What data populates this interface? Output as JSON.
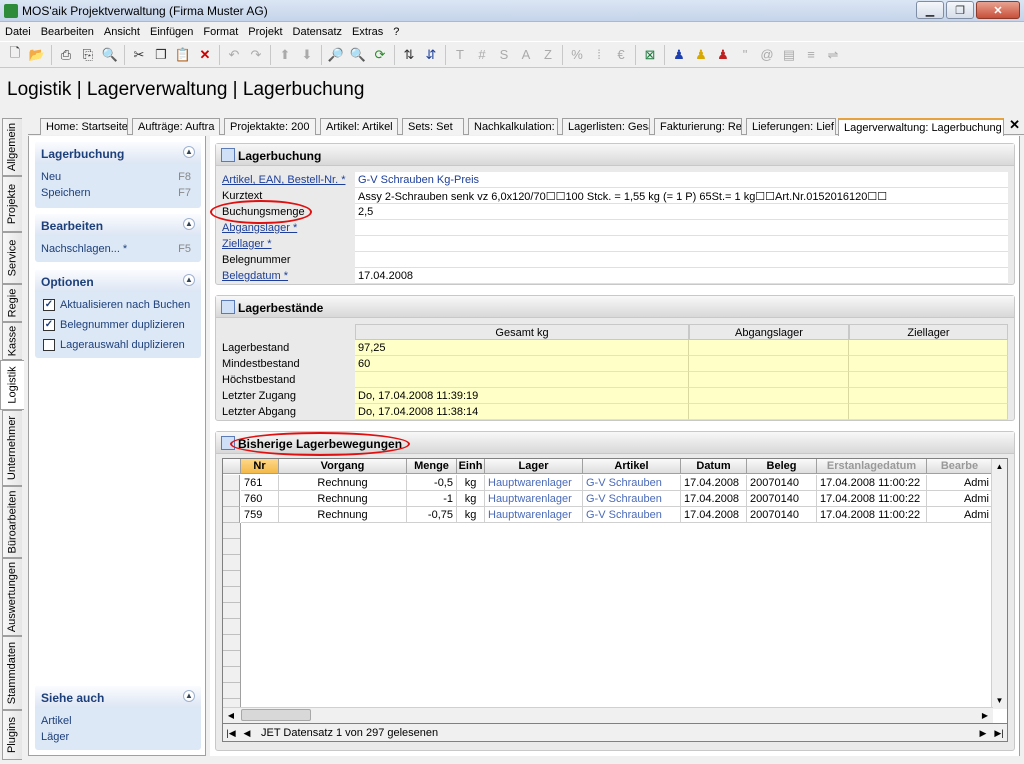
{
  "window": {
    "title": "MOS'aik Projektverwaltung (Firma Muster AG)"
  },
  "menu": [
    "Datei",
    "Bearbeiten",
    "Ansicht",
    "Einfügen",
    "Format",
    "Projekt",
    "Datensatz",
    "Extras",
    "?"
  ],
  "page_title": "Logistik | Lagerverwaltung | Lagerbuchung",
  "vtabs": [
    "Allgemein",
    "Projekte",
    "Service",
    "Regie",
    "Kasse",
    "Logistik",
    "Unternehmer",
    "Büroarbeiten",
    "Auswertungen",
    "Stammdaten",
    "Plugins"
  ],
  "tabs": [
    "Home: Startseite",
    "Aufträge: Auftra",
    "Projektakte: 200",
    "Artikel: Artikel",
    "Sets: Set",
    "Nachkalkulation: I",
    "Lagerlisten: Gesa",
    "Fakturierung: Re",
    "Lieferungen: Lief",
    "Lagerverwaltung: Lagerbuchung"
  ],
  "taskpane": {
    "lagerbuchung": {
      "title": "Lagerbuchung",
      "items": [
        {
          "label": "Neu",
          "key": "F8"
        },
        {
          "label": "Speichern",
          "key": "F7"
        }
      ]
    },
    "bearbeiten": {
      "title": "Bearbeiten",
      "items": [
        {
          "label": "Nachschlagen... *",
          "key": "F5"
        }
      ]
    },
    "optionen": {
      "title": "Optionen",
      "items": [
        {
          "label": "Aktualisieren nach Buchen",
          "checked": "✓"
        },
        {
          "label": "Belegnummer duplizieren",
          "checked": "✓"
        },
        {
          "label": "Lagerauswahl duplizieren",
          "checked": ""
        }
      ]
    },
    "siehe": {
      "title": "Siehe auch",
      "items": [
        {
          "label": "Artikel"
        },
        {
          "label": "Läger"
        }
      ]
    }
  },
  "booking": {
    "title": "Lagerbuchung",
    "fields": [
      {
        "label": "Artikel, EAN, Bestell-Nr. *",
        "value": "G-V Schrauben Kg-Preis"
      },
      {
        "label": "Kurztext",
        "value": "Assy 2-Schrauben senk vz 6,0x120/70☐☐100 Stck. = 1,55 kg (= 1 P) 65St.= 1 kg☐☐Art.Nr.0152016120☐☐"
      },
      {
        "label": "Buchungsmenge",
        "value": "2,5"
      },
      {
        "label": "Abgangslager *",
        "value": ""
      },
      {
        "label": "Ziellager *",
        "value": ""
      },
      {
        "label": "Belegnummer",
        "value": ""
      },
      {
        "label": "Belegdatum *",
        "value": "17.04.2008"
      }
    ]
  },
  "stock": {
    "title": "Lagerbestände",
    "columns": [
      "Gesamt kg",
      "Abgangslager",
      "Ziellager"
    ],
    "rows": [
      {
        "label": "Lagerbestand",
        "values": [
          "97,25",
          "",
          ""
        ]
      },
      {
        "label": "Mindestbestand",
        "values": [
          "60",
          "",
          ""
        ]
      },
      {
        "label": "Höchstbestand",
        "values": [
          "",
          "",
          ""
        ]
      },
      {
        "label": "Letzter Zugang",
        "values": [
          "Do, 17.04.2008 11:39:19",
          "",
          ""
        ]
      },
      {
        "label": "Letzter Abgang",
        "values": [
          "Do, 17.04.2008 11:38:14",
          "",
          ""
        ]
      }
    ]
  },
  "movements": {
    "title": "Bisherige Lagerbewegungen",
    "columns": [
      "Nr",
      "Vorgang",
      "Menge",
      "Einh",
      "Lager",
      "Artikel",
      "Datum",
      "Beleg",
      "Erstanlagedatum",
      "Bearbe"
    ],
    "rows": [
      [
        "761",
        "Rechnung",
        "-0,5",
        "kg",
        "Hauptwarenlager",
        "G-V Schrauben",
        "17.04.2008",
        "20070140",
        "17.04.2008 11:00:22",
        "Admi"
      ],
      [
        "760",
        "Rechnung",
        "-1",
        "kg",
        "Hauptwarenlager",
        "G-V Schrauben",
        "17.04.2008",
        "20070140",
        "17.04.2008 11:00:22",
        "Admi"
      ],
      [
        "759",
        "Rechnung",
        "-0,75",
        "kg",
        "Hauptwarenlager",
        "G-V Schrauben",
        "17.04.2008",
        "20070140",
        "17.04.2008 11:00:22",
        "Admi"
      ]
    ],
    "status": "JET Datensatz 1 von 297 gelesenen"
  }
}
